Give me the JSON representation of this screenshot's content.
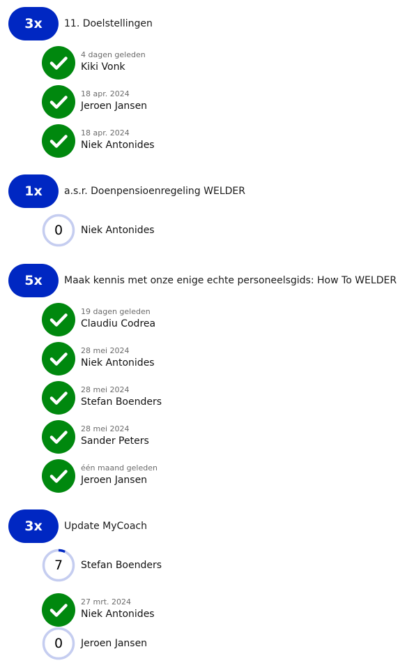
{
  "colors": {
    "badge": "#0027c2",
    "done": "#00880e",
    "ring": "#c5cdf0",
    "progress": "#0027c2"
  },
  "groups": [
    {
      "count": "3x",
      "title": "11. Doelstellingen",
      "items": [
        {
          "status": "done",
          "date": "4 dagen geleden",
          "name": "Kiki Vonk"
        },
        {
          "status": "done",
          "date": "18 apr. 2024",
          "name": "Jeroen Jansen"
        },
        {
          "status": "done",
          "date": "18 apr. 2024",
          "name": "Niek Antonides"
        }
      ]
    },
    {
      "count": "1x",
      "title": "a.s.r. Doenpensioenregeling WELDER",
      "items": [
        {
          "status": "progress",
          "value": "0",
          "progress": 0,
          "name": "Niek Antonides"
        }
      ]
    },
    {
      "count": "5x",
      "title": "Maak kennis met onze enige echte personeelsgids: How To WELDER",
      "items": [
        {
          "status": "done",
          "date": "19 dagen geleden",
          "name": "Claudiu Codrea"
        },
        {
          "status": "done",
          "date": "28 mei 2024",
          "name": "Niek Antonides"
        },
        {
          "status": "done",
          "date": "28 mei 2024",
          "name": "Stefan Boenders"
        },
        {
          "status": "done",
          "date": "28 mei 2024",
          "name": "Sander Peters"
        },
        {
          "status": "done",
          "date": "één maand geleden",
          "name": "Jeroen Jansen"
        }
      ]
    },
    {
      "count": "3x",
      "title": "Update MyCoach",
      "items": [
        {
          "status": "progress",
          "value": "7",
          "progress": 0.07,
          "name": "Stefan Boenders"
        },
        {
          "status": "done",
          "date": "27 mrt. 2024",
          "name": "Niek Antonides"
        },
        {
          "status": "progress",
          "value": "0",
          "progress": 0,
          "name": "Jeroen Jansen"
        }
      ]
    }
  ]
}
